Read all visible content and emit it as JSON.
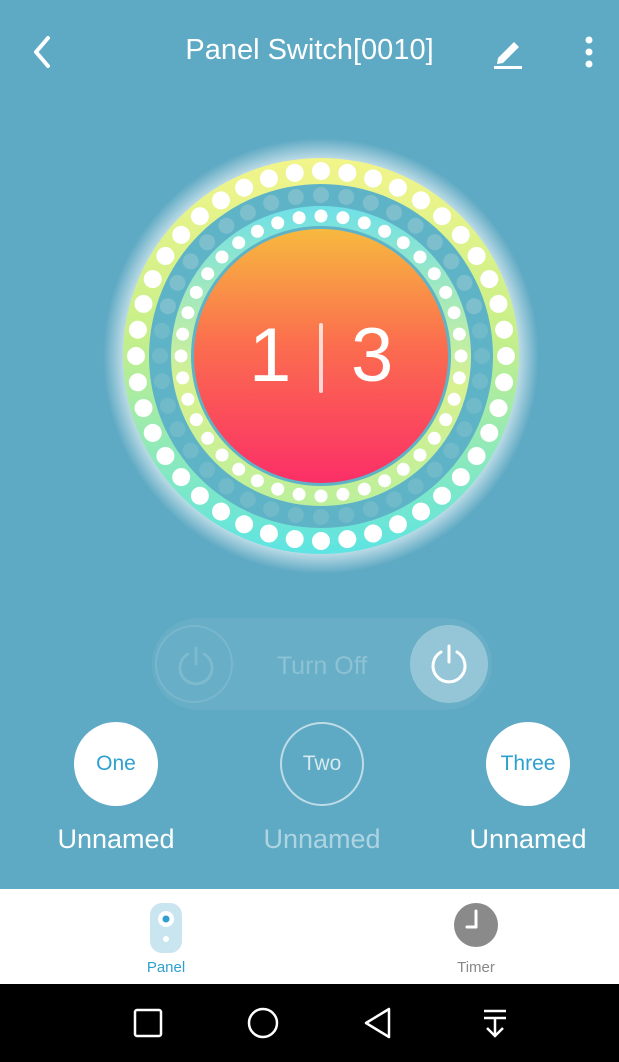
{
  "header": {
    "title": "Panel Switch[0010]",
    "back_icon": "back-arrow-icon",
    "edit_icon": "pencil-icon",
    "more_icon": "more-vertical-icon"
  },
  "dial": {
    "left_number": "1",
    "right_number": "3"
  },
  "power": {
    "label": "Turn Off"
  },
  "switches": [
    {
      "label": "One",
      "name": "Unnamed",
      "state": "on"
    },
    {
      "label": "Two",
      "name": "Unnamed",
      "state": "off"
    },
    {
      "label": "Three",
      "name": "Unnamed",
      "state": "on"
    }
  ],
  "tabs": [
    {
      "label": "Panel",
      "icon": "remote-icon",
      "active": true
    },
    {
      "label": "Timer",
      "icon": "clock-icon",
      "active": false
    }
  ],
  "colors": {
    "background": "#5ea9c3",
    "accent": "#2ea0cf",
    "core_top": "#f7b93f",
    "core_bottom": "#fb2f67"
  },
  "system_nav": [
    "recents-square-icon",
    "home-circle-icon",
    "back-triangle-icon",
    "notification-pull-icon"
  ]
}
